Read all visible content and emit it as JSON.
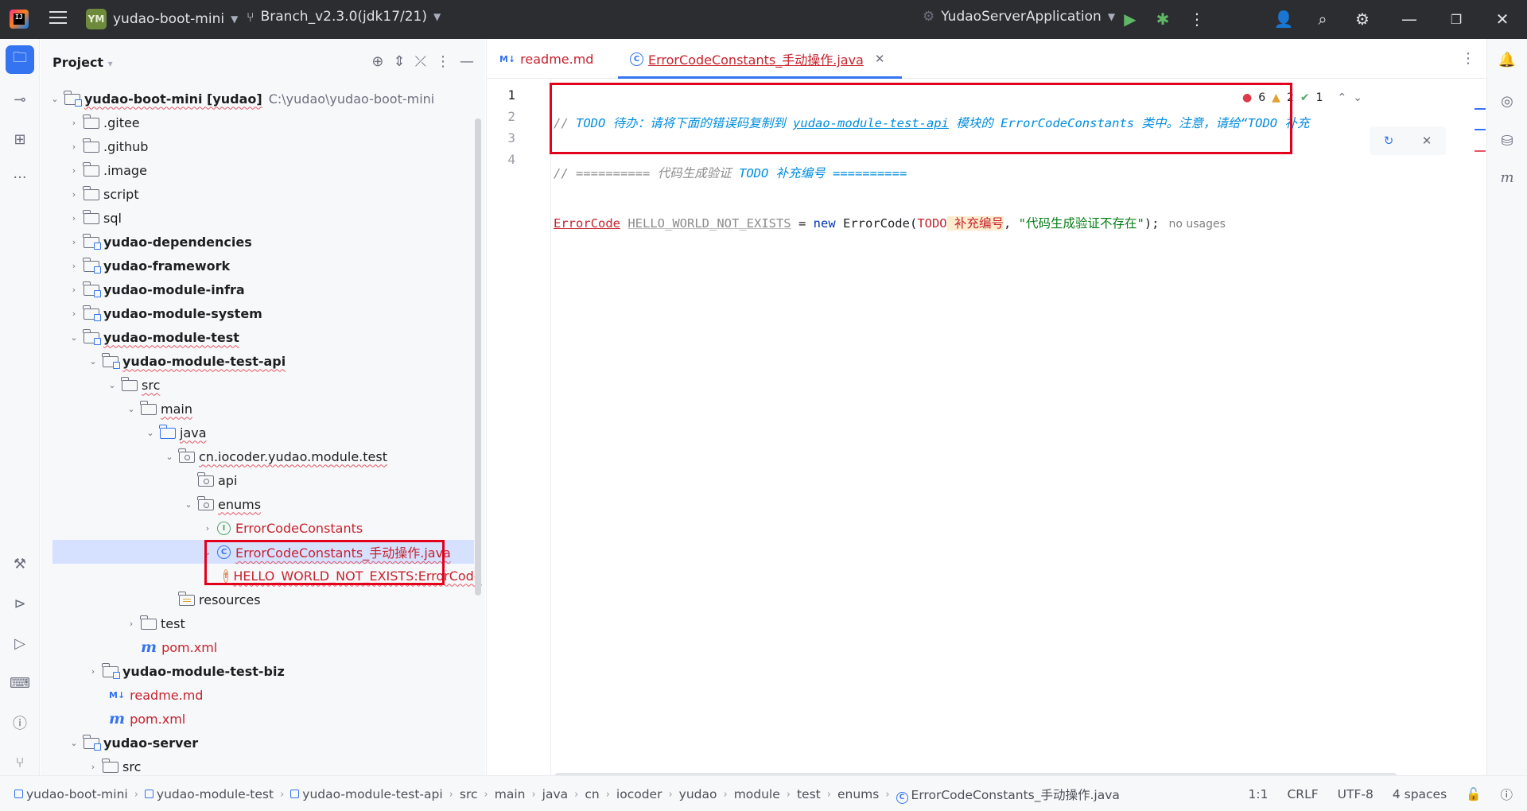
{
  "titlebar": {
    "logo_text": "IJ",
    "project_badge": "YM",
    "project_name": "yudao-boot-mini",
    "branch": "Branch_v2.3.0(jdk17/21)",
    "run_config": "YudaoServerApplication"
  },
  "project_panel": {
    "title": "Project",
    "tree": [
      {
        "label": "yudao-boot-mini [yudao]",
        "path": "C:\\yudao\\yudao-boot-mini"
      },
      {
        "label": ".gitee"
      },
      {
        "label": ".github"
      },
      {
        "label": ".image"
      },
      {
        "label": "script"
      },
      {
        "label": "sql"
      },
      {
        "label": "yudao-dependencies"
      },
      {
        "label": "yudao-framework"
      },
      {
        "label": "yudao-module-infra"
      },
      {
        "label": "yudao-module-system"
      },
      {
        "label": "yudao-module-test"
      },
      {
        "label": "yudao-module-test-api"
      },
      {
        "label": "src"
      },
      {
        "label": "main"
      },
      {
        "label": "java"
      },
      {
        "label": "cn.iocoder.yudao.module.test"
      },
      {
        "label": "api"
      },
      {
        "label": "enums"
      },
      {
        "label": "ErrorCodeConstants"
      },
      {
        "label": "ErrorCodeConstants_手动操作.java"
      },
      {
        "label": "HELLO_WORLD_NOT_EXISTS:ErrorCode"
      },
      {
        "label": "resources"
      },
      {
        "label": "test"
      },
      {
        "label": "pom.xml"
      },
      {
        "label": "yudao-module-test-biz"
      },
      {
        "label": "readme.md"
      },
      {
        "label": "pom.xml"
      },
      {
        "label": "yudao-server"
      },
      {
        "label": "src"
      }
    ]
  },
  "editor": {
    "tabs": [
      {
        "label": "readme.md",
        "icon": "M↓"
      },
      {
        "label": "ErrorCodeConstants_手动操作.java"
      }
    ],
    "line_numbers": [
      "1",
      "2",
      "3",
      "4"
    ],
    "code": {
      "l1_a": "// ",
      "l1_todo": "TODO",
      "l1_b": " 待办：请将下面的错误码复制到 ",
      "l1_mod": "yudao-module-test-api",
      "l1_c": " 模块的 ",
      "l1_cls": "ErrorCodeConstants",
      "l1_d": " 类中。注意，请给“",
      "l1_todo2": "TODO",
      "l1_e": " 补充",
      "l2_a": "// ========== 代码生成验证 ",
      "l2_todo": "TODO",
      "l2_b": " 补充编号 ==========",
      "l3_type": "ErrorCode",
      "l3_name": "HELLO_WORLD_NOT_EXISTS",
      "l3_eq": " = ",
      "l3_new": "new",
      "l3_ctor": " ErrorCode(",
      "l3_todo": "TODO",
      "l3_todo_text": " 补充编号",
      "l3_comma": ", ",
      "l3_str": "\"代码生成验证不存在\"",
      "l3_end": ");",
      "l3_hint": "no usages"
    },
    "inspections": {
      "errors": "6",
      "warnings": "2",
      "ok": "1"
    }
  },
  "statusbar": {
    "crumbs": [
      "yudao-boot-mini",
      "yudao-module-test",
      "yudao-module-test-api",
      "src",
      "main",
      "java",
      "cn",
      "iocoder",
      "yudao",
      "module",
      "test",
      "enums",
      "ErrorCodeConstants_手动操作.java"
    ],
    "position": "1:1",
    "line_sep": "CRLF",
    "encoding": "UTF-8",
    "indent": "4 spaces"
  },
  "colors": {
    "accent": "#3574f0",
    "error": "#c7222d",
    "highlight_box": "#e3001b",
    "titlebar": "#2b2d30"
  }
}
